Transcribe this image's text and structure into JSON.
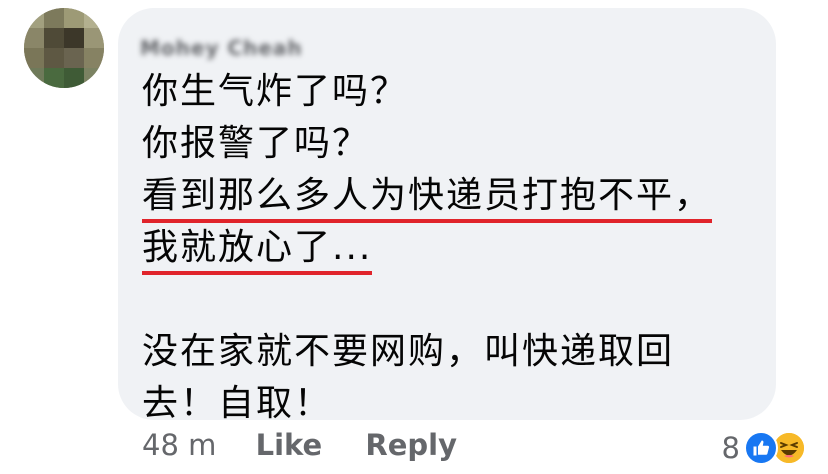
{
  "comment": {
    "author": "Mohey Cheah",
    "lines": [
      "你生气炸了吗？",
      "你报警了吗？",
      "看到那么多人为快递员打抱不平，",
      "我就放心了...",
      "",
      "没在家就不要网购，叫快递取回",
      "去！自取！"
    ],
    "underline_color": "#e0242b"
  },
  "actions": {
    "timestamp": "48 m",
    "like_label": "Like",
    "reply_label": "Reply"
  },
  "reactions": {
    "count": "8",
    "types": [
      "like-icon",
      "haha-icon"
    ]
  }
}
